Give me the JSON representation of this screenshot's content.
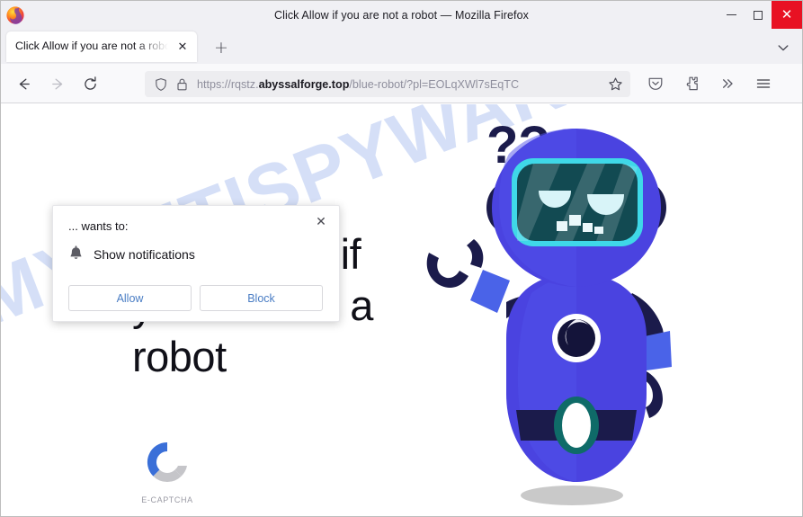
{
  "window": {
    "title": "Click Allow if you are not a robot — Mozilla Firefox",
    "minimize_label": "Minimize",
    "maximize_label": "Maximize",
    "close_label": "✕"
  },
  "tabs": [
    {
      "title": "Click Allow if you are not a robot",
      "close_label": "✕"
    }
  ],
  "tabstrip": {
    "newtab_label": "+",
    "list_all_tabs_label": "List all tabs"
  },
  "toolbar": {
    "back_label": "Go back one page",
    "forward_label": "Go forward one page",
    "reload_label": "Reload current page",
    "pocket_label": "Save to Pocket",
    "extensions_label": "Extensions",
    "overflow_label": "»",
    "menu_label": "Open application menu"
  },
  "urlbar": {
    "scheme": "https://",
    "subdomain": "rqstz.",
    "host": "abyssalforge.top",
    "path": "/blue-robot/?pl=EOLqXWl7sEqTC",
    "full_url": "https://rqstz.abyssalforge.top/blue-robot/?pl=EOLqXWl7sEqTC",
    "bookmark_label": "Bookmark this page"
  },
  "notification_popup": {
    "header": "... wants to:",
    "permission": "Show notifications",
    "allow_label": "Allow",
    "block_label": "Block",
    "close_label": "✕"
  },
  "page": {
    "headline": "Click Allow if you are not a robot",
    "watermark": "MYANTISPYWARE.COM",
    "captcha_label": "E-CAPTCHA",
    "robot_question_marks": "??"
  },
  "colors": {
    "accent_blue": "#4040e0",
    "robot_body": "#4343e0",
    "robot_dark": "#1b1b4b",
    "screen_teal": "#134b54",
    "screen_border": "#3fd8e8",
    "link_blue": "#4a7dc4",
    "close_red": "#e81123",
    "watermark_blue": "#c5d4f5",
    "captcha_blue": "#3a6fd8",
    "captcha_gray": "#c5c5c9"
  }
}
